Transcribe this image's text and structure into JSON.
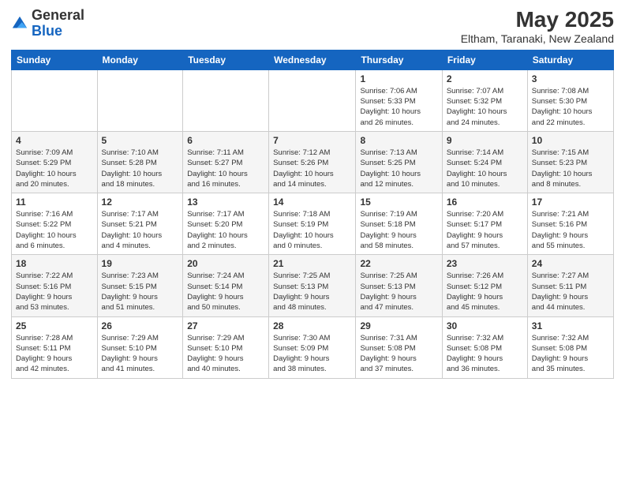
{
  "logo": {
    "general": "General",
    "blue": "Blue"
  },
  "title": "May 2025",
  "subtitle": "Eltham, Taranaki, New Zealand",
  "days_of_week": [
    "Sunday",
    "Monday",
    "Tuesday",
    "Wednesday",
    "Thursday",
    "Friday",
    "Saturday"
  ],
  "weeks": [
    [
      {
        "num": "",
        "info": ""
      },
      {
        "num": "",
        "info": ""
      },
      {
        "num": "",
        "info": ""
      },
      {
        "num": "",
        "info": ""
      },
      {
        "num": "1",
        "info": "Sunrise: 7:06 AM\nSunset: 5:33 PM\nDaylight: 10 hours\nand 26 minutes."
      },
      {
        "num": "2",
        "info": "Sunrise: 7:07 AM\nSunset: 5:32 PM\nDaylight: 10 hours\nand 24 minutes."
      },
      {
        "num": "3",
        "info": "Sunrise: 7:08 AM\nSunset: 5:30 PM\nDaylight: 10 hours\nand 22 minutes."
      }
    ],
    [
      {
        "num": "4",
        "info": "Sunrise: 7:09 AM\nSunset: 5:29 PM\nDaylight: 10 hours\nand 20 minutes."
      },
      {
        "num": "5",
        "info": "Sunrise: 7:10 AM\nSunset: 5:28 PM\nDaylight: 10 hours\nand 18 minutes."
      },
      {
        "num": "6",
        "info": "Sunrise: 7:11 AM\nSunset: 5:27 PM\nDaylight: 10 hours\nand 16 minutes."
      },
      {
        "num": "7",
        "info": "Sunrise: 7:12 AM\nSunset: 5:26 PM\nDaylight: 10 hours\nand 14 minutes."
      },
      {
        "num": "8",
        "info": "Sunrise: 7:13 AM\nSunset: 5:25 PM\nDaylight: 10 hours\nand 12 minutes."
      },
      {
        "num": "9",
        "info": "Sunrise: 7:14 AM\nSunset: 5:24 PM\nDaylight: 10 hours\nand 10 minutes."
      },
      {
        "num": "10",
        "info": "Sunrise: 7:15 AM\nSunset: 5:23 PM\nDaylight: 10 hours\nand 8 minutes."
      }
    ],
    [
      {
        "num": "11",
        "info": "Sunrise: 7:16 AM\nSunset: 5:22 PM\nDaylight: 10 hours\nand 6 minutes."
      },
      {
        "num": "12",
        "info": "Sunrise: 7:17 AM\nSunset: 5:21 PM\nDaylight: 10 hours\nand 4 minutes."
      },
      {
        "num": "13",
        "info": "Sunrise: 7:17 AM\nSunset: 5:20 PM\nDaylight: 10 hours\nand 2 minutes."
      },
      {
        "num": "14",
        "info": "Sunrise: 7:18 AM\nSunset: 5:19 PM\nDaylight: 10 hours\nand 0 minutes."
      },
      {
        "num": "15",
        "info": "Sunrise: 7:19 AM\nSunset: 5:18 PM\nDaylight: 9 hours\nand 58 minutes."
      },
      {
        "num": "16",
        "info": "Sunrise: 7:20 AM\nSunset: 5:17 PM\nDaylight: 9 hours\nand 57 minutes."
      },
      {
        "num": "17",
        "info": "Sunrise: 7:21 AM\nSunset: 5:16 PM\nDaylight: 9 hours\nand 55 minutes."
      }
    ],
    [
      {
        "num": "18",
        "info": "Sunrise: 7:22 AM\nSunset: 5:16 PM\nDaylight: 9 hours\nand 53 minutes."
      },
      {
        "num": "19",
        "info": "Sunrise: 7:23 AM\nSunset: 5:15 PM\nDaylight: 9 hours\nand 51 minutes."
      },
      {
        "num": "20",
        "info": "Sunrise: 7:24 AM\nSunset: 5:14 PM\nDaylight: 9 hours\nand 50 minutes."
      },
      {
        "num": "21",
        "info": "Sunrise: 7:25 AM\nSunset: 5:13 PM\nDaylight: 9 hours\nand 48 minutes."
      },
      {
        "num": "22",
        "info": "Sunrise: 7:25 AM\nSunset: 5:13 PM\nDaylight: 9 hours\nand 47 minutes."
      },
      {
        "num": "23",
        "info": "Sunrise: 7:26 AM\nSunset: 5:12 PM\nDaylight: 9 hours\nand 45 minutes."
      },
      {
        "num": "24",
        "info": "Sunrise: 7:27 AM\nSunset: 5:11 PM\nDaylight: 9 hours\nand 44 minutes."
      }
    ],
    [
      {
        "num": "25",
        "info": "Sunrise: 7:28 AM\nSunset: 5:11 PM\nDaylight: 9 hours\nand 42 minutes."
      },
      {
        "num": "26",
        "info": "Sunrise: 7:29 AM\nSunset: 5:10 PM\nDaylight: 9 hours\nand 41 minutes."
      },
      {
        "num": "27",
        "info": "Sunrise: 7:29 AM\nSunset: 5:10 PM\nDaylight: 9 hours\nand 40 minutes."
      },
      {
        "num": "28",
        "info": "Sunrise: 7:30 AM\nSunset: 5:09 PM\nDaylight: 9 hours\nand 38 minutes."
      },
      {
        "num": "29",
        "info": "Sunrise: 7:31 AM\nSunset: 5:08 PM\nDaylight: 9 hours\nand 37 minutes."
      },
      {
        "num": "30",
        "info": "Sunrise: 7:32 AM\nSunset: 5:08 PM\nDaylight: 9 hours\nand 36 minutes."
      },
      {
        "num": "31",
        "info": "Sunrise: 7:32 AM\nSunset: 5:08 PM\nDaylight: 9 hours\nand 35 minutes."
      }
    ]
  ]
}
